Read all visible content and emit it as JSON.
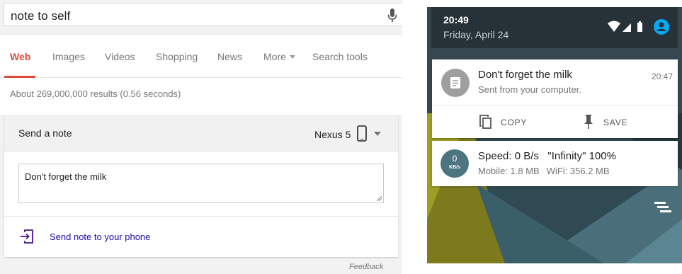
{
  "search": {
    "query": "note to self",
    "tabs": [
      {
        "label": "Web"
      },
      {
        "label": "Images"
      },
      {
        "label": "Videos"
      },
      {
        "label": "Shopping"
      },
      {
        "label": "News"
      },
      {
        "label": "More"
      },
      {
        "label": "Search tools"
      }
    ],
    "result_stats": "About 269,000,000 results (0.56 seconds)",
    "card": {
      "title": "Send a note",
      "device": "Nexus 5",
      "note_text": "Don't forget the milk",
      "send_label": "Send note to your phone"
    },
    "feedback": "Feedback",
    "colors": {
      "active_tab": "#dd4b39",
      "link": "#1a0dab"
    }
  },
  "android": {
    "time": "20:49",
    "date": "Friday, April 24",
    "notifications": [
      {
        "title": "Don't forget the milk",
        "subtitle": "Sent from your computer.",
        "time": "20:47",
        "actions": [
          {
            "label": "COPY",
            "icon": "copy-icon"
          },
          {
            "label": "SAVE",
            "icon": "pin-icon"
          }
        ]
      },
      {
        "gauge_value": "0",
        "gauge_unit": "KB/s",
        "speed": "Speed: 0 B/s",
        "quote": "\"Infinity\" 100%",
        "mobile": "Mobile: 1.8 MB",
        "wifi": "WiFi: 356.2 MB"
      }
    ],
    "colors": {
      "shade": "#263238",
      "avatar": "#9e9e9e",
      "gauge": "#4c7481",
      "account": "#03a9f4"
    }
  }
}
